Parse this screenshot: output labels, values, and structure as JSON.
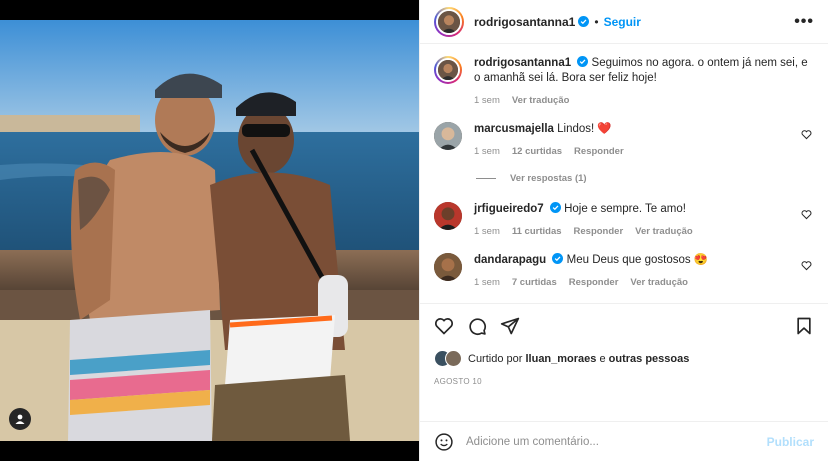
{
  "post": {
    "author": "rodrigosantanna1",
    "separator": "•",
    "follow_label": "Seguir",
    "more_label": "•••"
  },
  "caption": {
    "username": "rodrigosantanna1",
    "text": "Seguimos no agora. o ontem já nem sei, e o amanhã sei lá. Bora ser feliz hoje!",
    "time": "1 sem",
    "translate": "Ver tradução"
  },
  "comments": [
    {
      "username": "marcusmajella",
      "verified": false,
      "text": "Lindos! ❤️",
      "time": "1 sem",
      "likes": "12 curtidas",
      "reply": "Responder",
      "translate": ""
    },
    {
      "username": "jrfigueiredo7",
      "verified": true,
      "text": "Hoje e sempre. Te amo!",
      "time": "1 sem",
      "likes": "11 curtidas",
      "reply": "Responder",
      "translate": "Ver tradução"
    },
    {
      "username": "dandarapagu",
      "verified": true,
      "text": "Meu Deus que gostosos 😍",
      "time": "1 sem",
      "likes": "7 curtidas",
      "reply": "Responder",
      "translate": "Ver tradução"
    }
  ],
  "replies_link": "Ver respostas (1)",
  "liked_by": {
    "prefix": "Curtido por",
    "user": "lluan_moraes",
    "conj": "e",
    "others": "outras pessoas"
  },
  "date": "AGOSTO 10",
  "add_comment": {
    "placeholder": "Adicione um comentário...",
    "publish": "Publicar"
  },
  "colors": {
    "accent": "#0095f6",
    "heart_red": "#ed4956",
    "publish_disabled": "#b2dffc"
  },
  "icons": [
    "verified-badge-icon",
    "more-options-icon",
    "heart-icon",
    "like-icon",
    "comment-icon",
    "share-icon",
    "save-icon",
    "emoji-icon",
    "user-tag-icon"
  ]
}
